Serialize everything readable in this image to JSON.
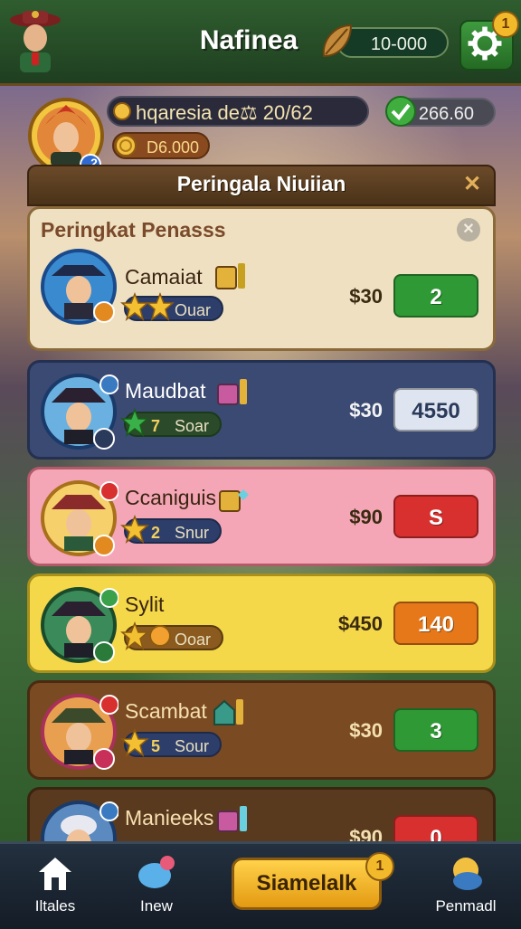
{
  "header": {
    "title": "Nafinea",
    "currency_value": "10-000",
    "notification_count": "1"
  },
  "player": {
    "name": "hqaresia de⚖ 20/62",
    "level": "2",
    "coins": "D6.000",
    "score": "266.60"
  },
  "panel": {
    "title": "Peringala Niuiian",
    "section_title": "Peringkat Penasss",
    "rows": [
      {
        "name": "Camaiat",
        "rating": "Ouar",
        "price": "$30",
        "button": "2",
        "color": "#2f9a35",
        "card_bg": "#efe0c2",
        "border": "#8a6a3a"
      },
      {
        "name": "Maudbat",
        "rating_num": "7",
        "rating": "Soar",
        "price": "$30",
        "button": "4550",
        "color": "#dfe5f0",
        "card_bg": "#3a4a72",
        "border": "#243050"
      },
      {
        "name": "Ccaniguis",
        "rating_num": "2",
        "rating": "Snur",
        "price": "$90",
        "button": "S",
        "color": "#d8302f",
        "card_bg": "#f4a6b6",
        "border": "#b25a6a"
      },
      {
        "name": "Sylit",
        "rating": "Ooar",
        "price": "$450",
        "button": "140",
        "color": "#e6781a",
        "card_bg": "#f4d84a",
        "border": "#a8901a"
      },
      {
        "name": "Scambat",
        "rating_num": "5",
        "rating": "Sour",
        "price": "$30",
        "button": "3",
        "color": "#2f9a35",
        "card_bg": "#7a4a22",
        "border": "#4a2a10"
      },
      {
        "name": "Manieeks",
        "price": "$90",
        "button": "0",
        "color": "#d8302f",
        "card_bg": "#5a3a1e",
        "border": "#3a2410"
      }
    ]
  },
  "nav": {
    "home_label": "Iltales",
    "new_label": "Inew",
    "main_label": "Siamelalk",
    "main_notification": "1",
    "profile_label": "Penmadl"
  }
}
